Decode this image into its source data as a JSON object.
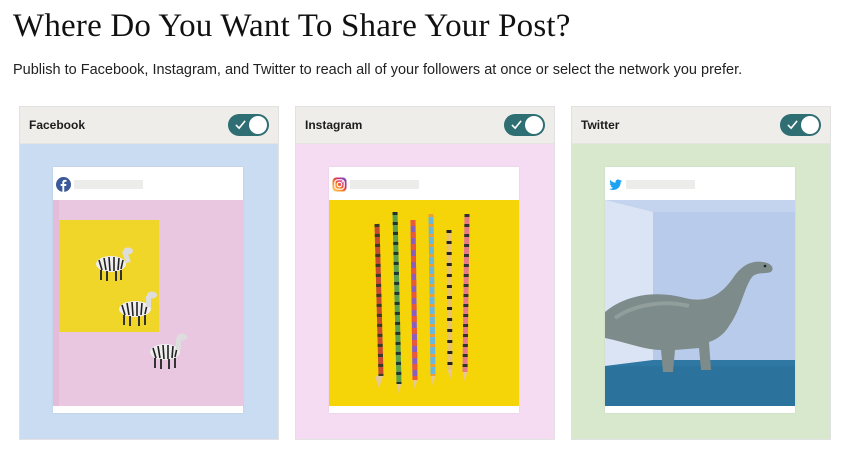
{
  "page": {
    "title": "Where Do You Want To Share Your Post?",
    "subtitle": "Publish to Facebook, Instagram, and Twitter to reach all of your followers at once or select the network you prefer."
  },
  "networks": [
    {
      "label": "Facebook",
      "enabled": true,
      "icon": "facebook-icon",
      "card_bg": "#c9dcf1",
      "icon_color": "#3b5998"
    },
    {
      "label": "Instagram",
      "enabled": true,
      "icon": "instagram-icon",
      "card_bg": "#f5dcf3",
      "icon_color": "#d6249f"
    },
    {
      "label": "Twitter",
      "enabled": true,
      "icon": "twitter-icon",
      "card_bg": "#d7e8cd",
      "icon_color": "#1da1f2"
    }
  ],
  "colors": {
    "toggle_on": "#2f6e73",
    "header_bg": "#efedea"
  }
}
